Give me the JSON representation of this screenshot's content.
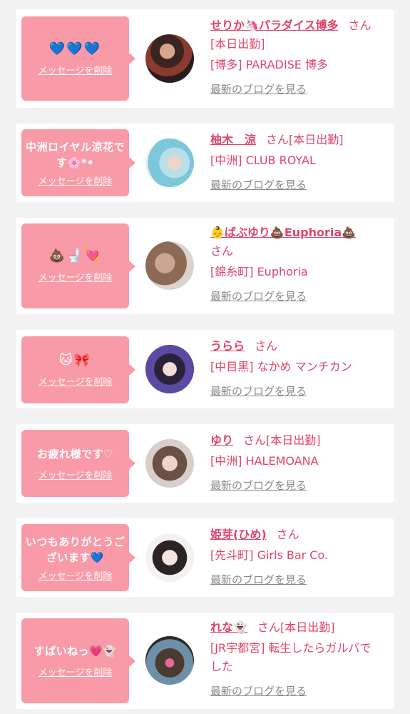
{
  "delete_label": "メッセージを削除",
  "blog_label": "最新のブログを見る",
  "accent_color": "#e0446a",
  "bubble_color": "#f99aa8",
  "cards": [
    {
      "message": "💙💙💙",
      "name": "せりか🦄パラダイス博多",
      "san": "さん",
      "status": "[本日出勤]",
      "shop": "[博多] PARADISE 博多"
    },
    {
      "message": "中洲ロイヤル涼花です🌸*•",
      "name": "柚木　涼",
      "san": "さん",
      "status": "[本日出勤]",
      "shop": "[中洲] CLUB ROYAL"
    },
    {
      "message": "💩🚽💘",
      "name": "👶ばぶゆり💩Euphoria💩",
      "san": "さん",
      "status": "",
      "shop": "[錦糸町] Euphoria"
    },
    {
      "message": "🐱🎀",
      "name": "うらら",
      "san": "さん",
      "status": "",
      "shop": "[中目黒] なかめ マンチカン"
    },
    {
      "message": "お疲れ様です♡",
      "name": "ゆり",
      "san": "さん",
      "status": "[本日出勤]",
      "shop": "[中洲] HALEMOANA"
    },
    {
      "message": "いつもありがとうございます💙",
      "name": "姫芽(ひめ)",
      "san": "さん",
      "status": "",
      "shop": "[先斗町] Girls Bar Co."
    },
    {
      "message": "すばいねっ💗👻",
      "name": "れな👻",
      "san": "さん",
      "status": "[本日出勤]",
      "shop": "[JR宇都宮] 転生したらガルバでした"
    }
  ]
}
